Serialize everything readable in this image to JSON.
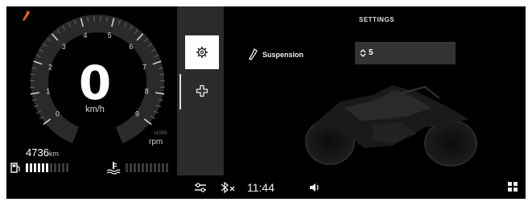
{
  "speedometer": {
    "speed": "0",
    "speed_unit": "km/h",
    "rpm_label": "rpm",
    "rpm_multiplier": "x1000",
    "tick_labels": [
      "0",
      "1",
      "2",
      "3",
      "4",
      "5",
      "6",
      "7",
      "8",
      "9"
    ]
  },
  "odometer": {
    "value": "4736",
    "unit": "km"
  },
  "fuel_level": 0.55,
  "temperature_level": 0.0,
  "colors": {
    "warning_icon": "#e86a12",
    "background": "#000000",
    "strip": "#2b2b2b",
    "value_box": "#333333"
  },
  "side_tabs": [
    {
      "icon": "gear-icon",
      "selected": true
    },
    {
      "icon": "cross-icon",
      "selected": false
    }
  ],
  "settings": {
    "title": "SETTINGS",
    "rows": [
      {
        "icon": "wrench-icon",
        "label": "Suspension",
        "value": "5"
      }
    ]
  },
  "bottom_bar": {
    "time": "11:44"
  }
}
